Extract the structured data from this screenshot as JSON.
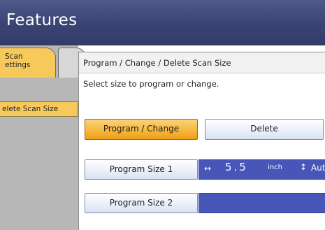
{
  "title_bar": {
    "title": "e Features"
  },
  "left_panel": {
    "tab_scan_settings": "Scan\nettings",
    "menu_delete_scan_size": "elete Scan Size"
  },
  "dialog": {
    "title": "Program / Change / Delete Scan Size",
    "instruction": "Select size to program or change.",
    "mode_buttons": {
      "program_change": "Program / Change",
      "delete": "Delete"
    },
    "program_sizes": [
      {
        "label": "Program Size 1",
        "width_icon": "left-right-arrow-icon",
        "value": "5.5",
        "unit": "inch",
        "height_icon": "up-down-arrow-icon",
        "height_value": "Aut"
      },
      {
        "label": "Program Size 2"
      }
    ]
  },
  "colors": {
    "title_bar": "#3a4373",
    "selected_button": "#f5b83d",
    "size_bar": "#4756b7",
    "left_panel": "#b7b7b7"
  }
}
